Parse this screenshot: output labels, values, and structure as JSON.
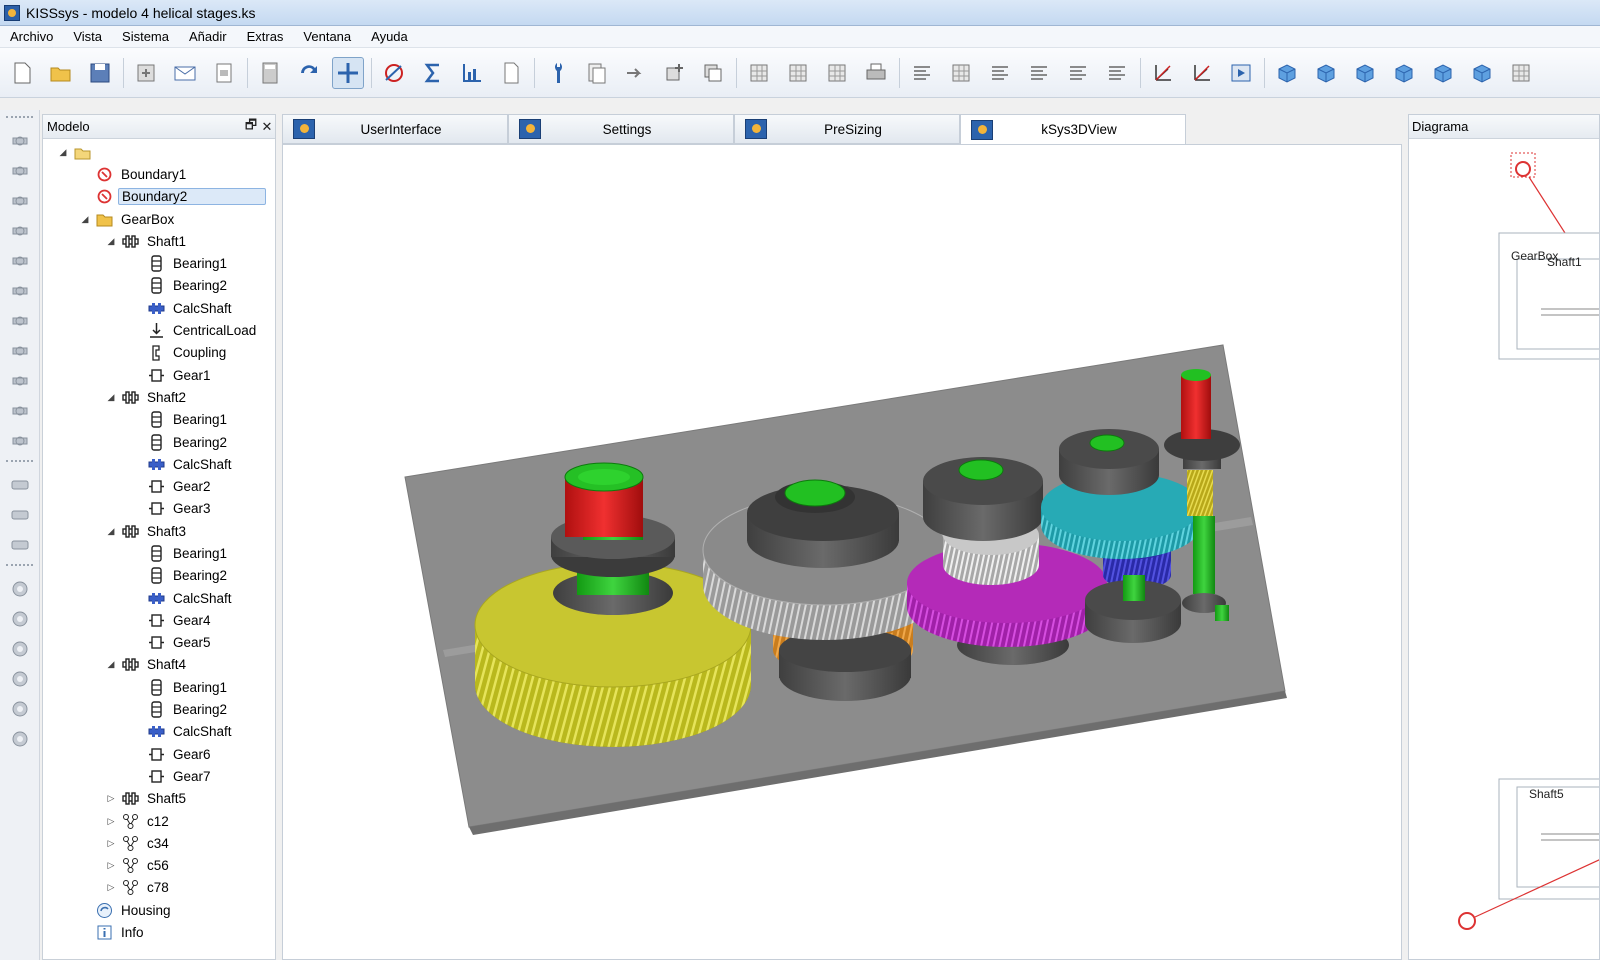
{
  "window": {
    "title": "KISSsys - modelo 4 helical stages.ks"
  },
  "menu": [
    "Archivo",
    "Vista",
    "Sistema",
    "Añadir",
    "Extras",
    "Ventana",
    "Ayuda"
  ],
  "toolbar": {
    "buttons": [
      "new-file-icon",
      "open-folder-icon",
      "save-icon",
      "export-icon",
      "mail-icon",
      "print-setup-icon",
      "calculator-icon",
      "refresh-icon",
      "move-icon",
      "kiss-calc-icon",
      "sigma-icon",
      "chart-icon",
      "document-icon",
      "wrench-icon",
      "report-icon",
      "arrow-icon",
      "cube-add-icon",
      "copy-icon",
      "table-icon",
      "table-add-icon",
      "table-edit-icon",
      "printer-icon",
      "text-box-icon",
      "erase-icon",
      "text-underline-icon",
      "align-left-icon",
      "align-center-icon",
      "align-right-icon",
      "axes-zx-icon",
      "axes-zy-icon",
      "play-icon",
      "view-cube-front-icon",
      "view-cube-top-icon",
      "view-cube-side-icon",
      "view-cube-wire-icon",
      "view-cube-iso-icon",
      "view-cube-back-icon",
      "view-rotate-icon"
    ],
    "active_index": 8
  },
  "model_panel": {
    "title": "Modelo",
    "tree": [
      {
        "label": "",
        "level": 0,
        "icon": "folder-open-icon",
        "twisty": "open"
      },
      {
        "label": "Boundary1",
        "level": 1,
        "icon": "boundary-icon",
        "twisty": ""
      },
      {
        "label": "Boundary2",
        "level": 1,
        "icon": "boundary-icon",
        "twisty": "",
        "selected": true
      },
      {
        "label": "GearBox",
        "level": 1,
        "icon": "folder-icon",
        "twisty": "open"
      },
      {
        "label": "Shaft1",
        "level": 2,
        "icon": "shaft-icon",
        "twisty": "open"
      },
      {
        "label": "Bearing1",
        "level": 3,
        "icon": "bearing-icon",
        "twisty": ""
      },
      {
        "label": "Bearing2",
        "level": 3,
        "icon": "bearing-icon",
        "twisty": ""
      },
      {
        "label": "CalcShaft",
        "level": 3,
        "icon": "calc-shaft-icon",
        "twisty": ""
      },
      {
        "label": "CentricalLoad",
        "level": 3,
        "icon": "load-icon",
        "twisty": ""
      },
      {
        "label": "Coupling",
        "level": 3,
        "icon": "coupling-icon",
        "twisty": ""
      },
      {
        "label": "Gear1",
        "level": 3,
        "icon": "gear-element-icon",
        "twisty": ""
      },
      {
        "label": "Shaft2",
        "level": 2,
        "icon": "shaft-icon",
        "twisty": "open"
      },
      {
        "label": "Bearing1",
        "level": 3,
        "icon": "bearing-icon",
        "twisty": ""
      },
      {
        "label": "Bearing2",
        "level": 3,
        "icon": "bearing-icon",
        "twisty": ""
      },
      {
        "label": "CalcShaft",
        "level": 3,
        "icon": "calc-shaft-icon",
        "twisty": ""
      },
      {
        "label": "Gear2",
        "level": 3,
        "icon": "gear-element-icon",
        "twisty": ""
      },
      {
        "label": "Gear3",
        "level": 3,
        "icon": "gear-element-icon",
        "twisty": ""
      },
      {
        "label": "Shaft3",
        "level": 2,
        "icon": "shaft-icon",
        "twisty": "open"
      },
      {
        "label": "Bearing1",
        "level": 3,
        "icon": "bearing-icon",
        "twisty": ""
      },
      {
        "label": "Bearing2",
        "level": 3,
        "icon": "bearing-icon",
        "twisty": ""
      },
      {
        "label": "CalcShaft",
        "level": 3,
        "icon": "calc-shaft-icon",
        "twisty": ""
      },
      {
        "label": "Gear4",
        "level": 3,
        "icon": "gear-element-icon",
        "twisty": ""
      },
      {
        "label": "Gear5",
        "level": 3,
        "icon": "gear-element-icon",
        "twisty": ""
      },
      {
        "label": "Shaft4",
        "level": 2,
        "icon": "shaft-icon",
        "twisty": "open"
      },
      {
        "label": "Bearing1",
        "level": 3,
        "icon": "bearing-icon",
        "twisty": ""
      },
      {
        "label": "Bearing2",
        "level": 3,
        "icon": "bearing-icon",
        "twisty": ""
      },
      {
        "label": "CalcShaft",
        "level": 3,
        "icon": "calc-shaft-icon",
        "twisty": ""
      },
      {
        "label": "Gear6",
        "level": 3,
        "icon": "gear-element-icon",
        "twisty": ""
      },
      {
        "label": "Gear7",
        "level": 3,
        "icon": "gear-element-icon",
        "twisty": ""
      },
      {
        "label": "Shaft5",
        "level": 2,
        "icon": "shaft-icon",
        "twisty": "closed"
      },
      {
        "label": "c12",
        "level": 2,
        "icon": "connection-icon",
        "twisty": "closed"
      },
      {
        "label": "c34",
        "level": 2,
        "icon": "connection-icon",
        "twisty": "closed"
      },
      {
        "label": "c56",
        "level": 2,
        "icon": "connection-icon",
        "twisty": "closed"
      },
      {
        "label": "c78",
        "level": 2,
        "icon": "connection-icon",
        "twisty": "closed"
      },
      {
        "label": "Housing",
        "level": 1,
        "icon": "housing-icon",
        "twisty": ""
      },
      {
        "label": "Info",
        "level": 1,
        "icon": "info-icon",
        "twisty": ""
      }
    ]
  },
  "tabs": [
    {
      "label": "UserInterface",
      "active": false
    },
    {
      "label": "Settings",
      "active": false
    },
    {
      "label": "PreSizing",
      "active": false
    },
    {
      "label": "kSys3DView",
      "active": true
    }
  ],
  "diagram_panel": {
    "title": "Diagrama",
    "labels": [
      "GearBox",
      "Shaft1",
      "Shaft5"
    ]
  },
  "left_strip_icons": [
    "shaft-tool-icon",
    "shaft-tool-2-icon",
    "bearing-tool-icon",
    "gear-pair-tool-icon",
    "planet-tool-icon",
    "planet-2-tool-icon",
    "wheel-tool-icon",
    "bevel-tool-icon",
    "worm-tool-icon",
    "spring-tool-icon",
    "connector-tool-icon",
    "coupling-tool-icon",
    "coupling-2-tool-icon",
    "coupling-3-tool-icon",
    "circle-tool-icon",
    "circle-2-tool-icon",
    "circle-3-tool-icon",
    "gear-tool-icon",
    "gear-2-tool-icon",
    "gear-3-tool-icon"
  ],
  "colors": {
    "accent": "#2c63ad",
    "selection": "#dce9f8",
    "housing": "#8c8c8c"
  }
}
